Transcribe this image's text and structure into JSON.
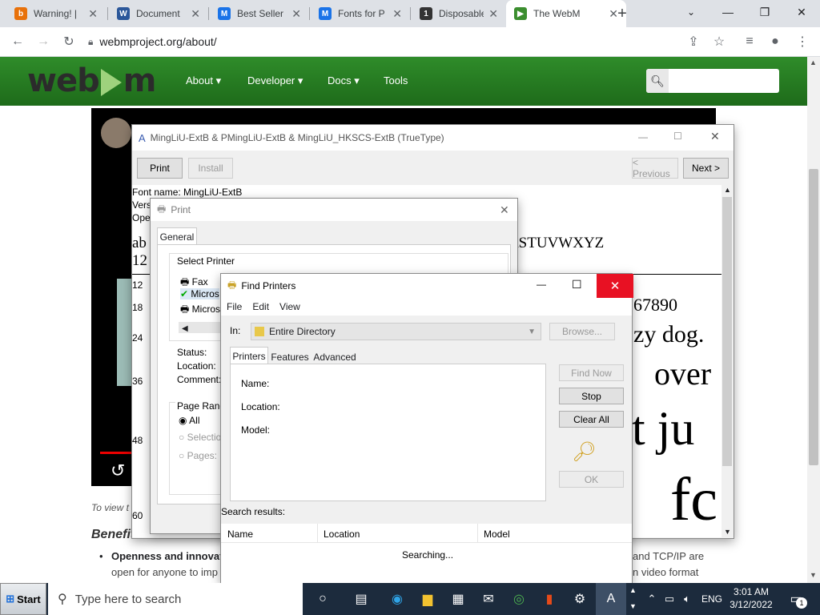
{
  "browser": {
    "tabs": [
      {
        "title": "Warning! |",
        "icon_color": "#e8710a",
        "icon_text": "b"
      },
      {
        "title": "Document",
        "icon_color": "#2b579a",
        "icon_text": "W"
      },
      {
        "title": "Best Seller",
        "icon_color": "#1a73e8",
        "icon_text": "M"
      },
      {
        "title": "Fonts for P",
        "icon_color": "#1a73e8",
        "icon_text": "M"
      },
      {
        "title": "Disposable",
        "icon_color": "#333333",
        "icon_text": "1"
      },
      {
        "title": "The WebM",
        "icon_color": "#3b8e2f",
        "icon_text": "▶"
      }
    ],
    "new_tab": "+",
    "url": "webmproject.org/about/"
  },
  "webm": {
    "logo_left": "web",
    "logo_right": "m",
    "nav": [
      "About ▾",
      "Developer ▾",
      "Docs ▾",
      "Tools"
    ],
    "caption": "To view t",
    "benefits_heading": "Benefits of WebM",
    "bullet1_bold": "Openness and innovati",
    "bullet1_right": "and TCP/IP are",
    "bullet2_left": "open for anyone to imp",
    "bullet2_right": "n video format",
    "video_numbers": [
      "12",
      "18",
      "24",
      "36",
      "48",
      "60"
    ]
  },
  "font_viewer": {
    "title": "MingLiU-ExtB & PMingLiU-ExtB  & MingLiU_HKSCS-ExtB  (TrueType)",
    "print": "Print",
    "install": "Install",
    "prev": "< Previous",
    "next": "Next >",
    "font_name": "Font name: MingLiU-ExtB",
    "version": "Vers",
    "ope": "Ope",
    "alphabet_left": "ab",
    "alphabet_right": "RSTUVWXYZ",
    "digits_left": "12",
    "digits_right": "67890",
    "sample_18": "zy dog.",
    "sample_24": "over",
    "sample_36": "t ju",
    "sample_48": "fc",
    "sizes": [
      "12",
      "18",
      "24",
      "36",
      "48",
      "60"
    ]
  },
  "print_dialog": {
    "title": "Print",
    "tab_general": "General",
    "select_printer": "Select Printer",
    "printers": [
      "Fax",
      "Micros",
      "Micros"
    ],
    "status": "Status:",
    "location": "Location:",
    "comment": "Comment:",
    "page_range": "Page Range",
    "all": "All",
    "selection": "Selection",
    "pages": "Pages:"
  },
  "find_printers": {
    "title": "Find Printers",
    "menu": [
      "File",
      "Edit",
      "View"
    ],
    "in_label": "In:",
    "in_value": "Entire Directory",
    "browse": "Browse...",
    "tabs": [
      "Printers",
      "Features",
      "Advanced"
    ],
    "name": "Name:",
    "location": "Location:",
    "model": "Model:",
    "find_now": "Find Now",
    "stop": "Stop",
    "clear_all": "Clear All",
    "ok": "OK",
    "search_results": "Search results:",
    "columns": [
      "Name",
      "Location",
      "Model"
    ],
    "status": "Searching..."
  },
  "taskbar": {
    "start": "Start",
    "search_placeholder": "Type here to search",
    "time": "3:01 AM",
    "date": "3/12/2022",
    "lang": "ENG",
    "notif_count": "1"
  }
}
